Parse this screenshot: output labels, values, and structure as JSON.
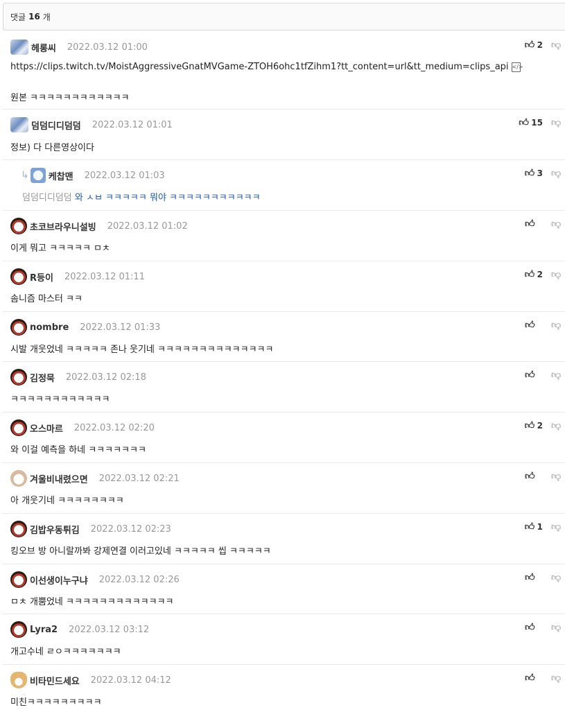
{
  "header": {
    "prefix": "댓글",
    "count": "16",
    "suffix": "개"
  },
  "comments": [
    {
      "nick": "헤롱씨",
      "date": "2022.03.12 01:00",
      "line1": "https://clips.twitch.tv/MoistAggressiveGnatMVGame-ZTOH6ohc1tfZihm1?tt_content=url&tt_medium=clips_api",
      "line2": "원본 ㅋㅋㅋㅋㅋㅋㅋㅋㅋㅋㅋㅋ",
      "up": "2",
      "avatar": "bird-avatar"
    },
    {
      "nick": "덤덤디디덤덤",
      "date": "2022.03.12 01:01",
      "text": "정보) 다 다른영상이다",
      "up": "15",
      "avatar": "bird-avatar"
    },
    {
      "nick": "케찹맨",
      "date": "2022.03.12 01:03",
      "ref": "덤덤디디덤덤",
      "text": "와 ㅅㅂ ㅋㅋㅋㅋㅋ 뭐야 ㅋㅋㅋㅋㅋㅋㅋㅋㅋㅋㅋ",
      "up": "3",
      "avatar": "ghost-avatar"
    },
    {
      "nick": "초코브라우니설빙",
      "date": "2022.03.12 01:02",
      "text": "이게 뭐고 ㅋㅋㅋㅋㅋ ㅁㅊ",
      "up": "",
      "avatar": "puppy-avatar"
    },
    {
      "nick": "R등이",
      "date": "2022.03.12 01:11",
      "text": "솜니즘 마스터 ㅋㅋ",
      "up": "2",
      "avatar": "puppy-avatar"
    },
    {
      "nick": "nombre",
      "date": "2022.03.12 01:33",
      "text": "시발 개웃었네 ㅋㅋㅋㅋㅋ 존나 웃기네 ㅋㅋㅋㅋㅋㅋㅋㅋㅋㅋㅋㅋㅋㅋ",
      "up": "",
      "avatar": "puppy-avatar"
    },
    {
      "nick": "김정묵",
      "date": "2022.03.12 02:18",
      "text": "ㅋㅋㅋㅋㅋㅋㅋㅋㅋㅋㅋㅋ",
      "up": "",
      "avatar": "puppy-avatar"
    },
    {
      "nick": "오스마르",
      "date": "2022.03.12 02:20",
      "text": "와 이걸 예측을 하네 ㅋㅋㅋㅋㅋㅋㅋ",
      "up": "2",
      "avatar": "puppy-avatar"
    },
    {
      "nick": "겨울비내렸으면",
      "date": "2022.03.12 02:21",
      "text": "아 개웃기네 ㅋㅋㅋㅋㅋㅋㅋㅋ",
      "up": "",
      "avatar": "puppy-avatar"
    },
    {
      "nick": "김밥우동튀김",
      "date": "2022.03.12 02:23",
      "text": "킹오브 방 아니랄까봐 강제연결 이러고있네 ㅋㅋㅋㅋㅋ 씹 ㅋㅋㅋㅋㅋ",
      "up": "1",
      "avatar": "puppy-avatar"
    },
    {
      "nick": "이선생이누구냐",
      "date": "2022.03.12 02:26",
      "text": "ㅁㅊ 개뿜었네 ㅋㅋㅋㅋㅋㅋㅋㅋㅋㅋㅋㅋㅋ",
      "up": "",
      "avatar": "puppy-avatar"
    },
    {
      "nick": "Lyra2",
      "date": "2022.03.12 03:12",
      "text": "개고수네 ㄹㅇㅋㅋㅋㅋㅋㅋㅋ",
      "up": "",
      "avatar": "puppy-avatar"
    },
    {
      "nick": "비타민드세요",
      "date": "2022.03.12 04:12",
      "text": "미친ㅋㅋㅋㅋㅋㅋㅋㅋㅋ",
      "up": "",
      "avatar": "fox-avatar"
    }
  ]
}
